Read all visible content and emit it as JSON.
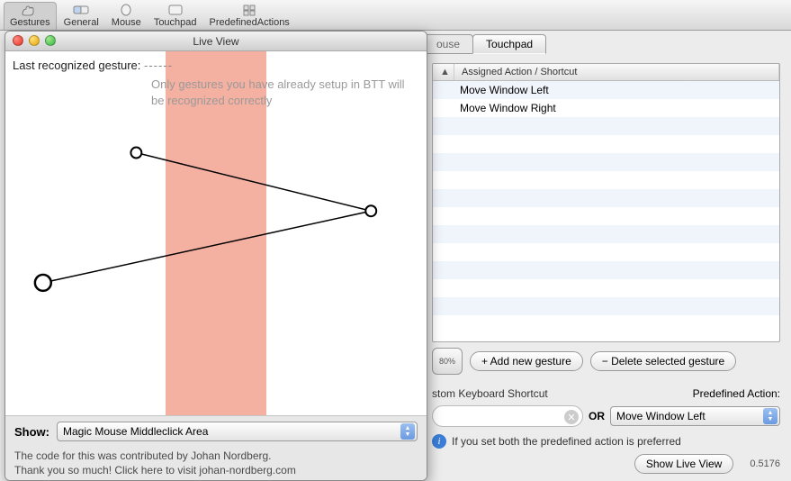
{
  "toolbar": {
    "items": [
      {
        "label": "Gestures"
      },
      {
        "label": "General"
      },
      {
        "label": "Mouse"
      },
      {
        "label": "Touchpad"
      },
      {
        "label": "PredefinedActions"
      }
    ]
  },
  "tabs": {
    "partial": "ouse",
    "active": "Touchpad"
  },
  "table": {
    "sort_indicator": "▲",
    "header": "Assigned Action / Shortcut",
    "rows": [
      {
        "action": "Move Window Left"
      },
      {
        "action": "Move Window Right"
      }
    ]
  },
  "trackpad_badge": "80%",
  "buttons": {
    "add": "+ Add new gesture",
    "delete": "− Delete selected gesture",
    "show_live": "Show Live View"
  },
  "shortcut": {
    "label_partial": "stom Keyboard Shortcut",
    "predef_label": "Predefined Action:",
    "or": "OR",
    "predef_value": "Move Window Left"
  },
  "info_text": "If you set both the predefined action is preferred",
  "version": "0.5176",
  "liveview": {
    "title": "Live View",
    "last_label": "Last recognized gesture:",
    "dashes": "------",
    "hint": "Only gestures you have already setup in BTT will be recognized correctly",
    "show_label": "Show:",
    "show_value": "Magic Mouse Middleclick Area",
    "credit1": "The code for this was contributed by Johan Nordberg.",
    "credit2": "Thank you so much! Click here to visit johan-nordberg.com"
  }
}
